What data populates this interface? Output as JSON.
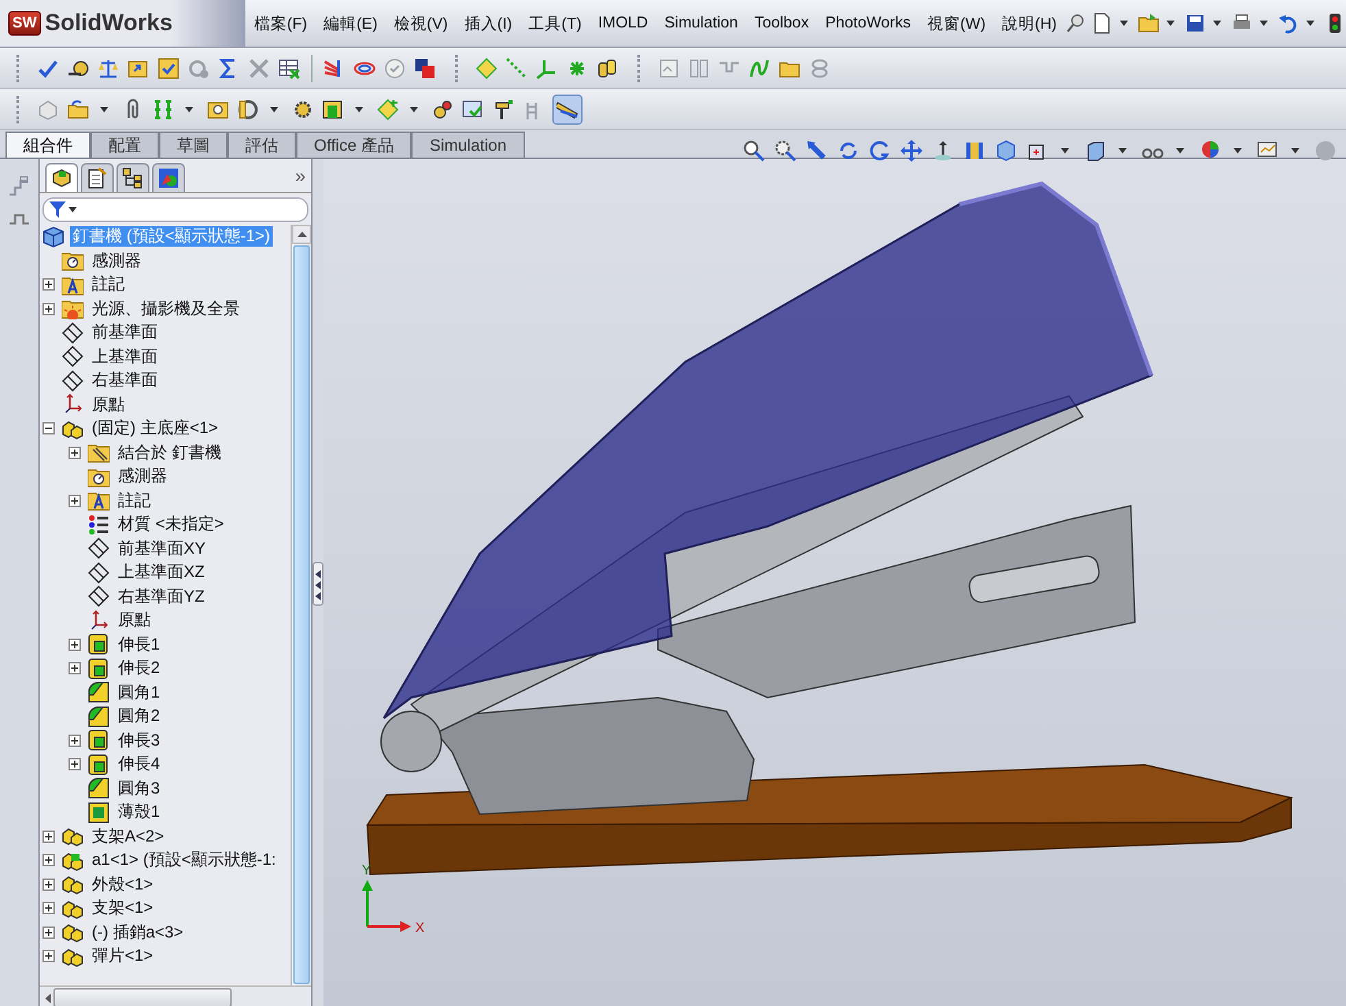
{
  "logo": {
    "badge": "SW",
    "name": "SolidWorks"
  },
  "menu": [
    "檔案(F)",
    "編輯(E)",
    "檢視(V)",
    "插入(I)",
    "工具(T)",
    "IMOLD",
    "Simulation",
    "Toolbox",
    "PhotoWorks",
    "視窗(W)",
    "說明(H)"
  ],
  "command_tabs": [
    {
      "label": "組合件",
      "selected": true
    },
    {
      "label": "配置",
      "selected": false
    },
    {
      "label": "草圖",
      "selected": false
    },
    {
      "label": "評估",
      "selected": false
    },
    {
      "label": "Office 產品",
      "selected": false
    },
    {
      "label": "Simulation",
      "selected": false
    }
  ],
  "panel": {
    "tabs": [
      {
        "selected": true
      },
      {
        "selected": false
      },
      {
        "selected": false
      },
      {
        "selected": false
      }
    ],
    "more": "»"
  },
  "tree": [
    {
      "label": "釘書機 (預設<顯示狀態-1>)",
      "kind": "assembly",
      "selected": true,
      "children": [
        {
          "label": "感測器",
          "kind": "folder-sensor",
          "selected": false
        },
        {
          "label": "註記",
          "kind": "folder-note",
          "selected": false,
          "expanded": false
        },
        {
          "label": "光源、攝影機及全景",
          "kind": "folder-light",
          "selected": false,
          "expanded": false
        },
        {
          "label": "前基準面",
          "kind": "plane",
          "selected": false
        },
        {
          "label": "上基準面",
          "kind": "plane",
          "selected": false
        },
        {
          "label": "右基準面",
          "kind": "plane",
          "selected": false
        },
        {
          "label": "原點",
          "kind": "origin",
          "selected": false
        },
        {
          "label": "(固定) 主底座<1>",
          "kind": "part",
          "selected": false,
          "expanded": true,
          "children": [
            {
              "label": "結合於 釘書機",
              "kind": "folder-mate",
              "selected": false,
              "expanded": false
            },
            {
              "label": "感測器",
              "kind": "folder-sensor",
              "selected": false
            },
            {
              "label": "註記",
              "kind": "folder-note",
              "selected": false,
              "expanded": false
            },
            {
              "label": "材質 <未指定>",
              "kind": "material",
              "selected": false
            },
            {
              "label": "前基準面XY",
              "kind": "plane",
              "selected": false
            },
            {
              "label": "上基準面XZ",
              "kind": "plane",
              "selected": false
            },
            {
              "label": "右基準面YZ",
              "kind": "plane",
              "selected": false
            },
            {
              "label": "原點",
              "kind": "origin",
              "selected": false
            },
            {
              "label": "伸長1",
              "kind": "extrude",
              "selected": false,
              "expanded": false
            },
            {
              "label": "伸長2",
              "kind": "extrude",
              "selected": false,
              "expanded": false
            },
            {
              "label": "圓角1",
              "kind": "fillet",
              "selected": false
            },
            {
              "label": "圓角2",
              "kind": "fillet",
              "selected": false
            },
            {
              "label": "伸長3",
              "kind": "extrude",
              "selected": false,
              "expanded": false
            },
            {
              "label": "伸長4",
              "kind": "extrude",
              "selected": false,
              "expanded": false
            },
            {
              "label": "圓角3",
              "kind": "fillet",
              "selected": false
            },
            {
              "label": "薄殼1",
              "kind": "shell",
              "selected": false
            }
          ]
        },
        {
          "label": "支架A<2>",
          "kind": "part",
          "selected": false,
          "expanded": false
        },
        {
          "label": "a1<1> (預設<顯示狀態-1:",
          "kind": "part-edited",
          "selected": false,
          "expanded": false
        },
        {
          "label": "外殼<1>",
          "kind": "part",
          "selected": false,
          "expanded": false
        },
        {
          "label": "支架<1>",
          "kind": "part",
          "selected": false,
          "expanded": false
        },
        {
          "label": "(-) 插銷a<3>",
          "kind": "part",
          "selected": false,
          "expanded": false
        },
        {
          "label": "彈片<1>",
          "kind": "part",
          "selected": false,
          "expanded": false
        }
      ]
    }
  ],
  "viewport": {
    "triad": {
      "y_label": "Y",
      "x_label": "X"
    }
  }
}
